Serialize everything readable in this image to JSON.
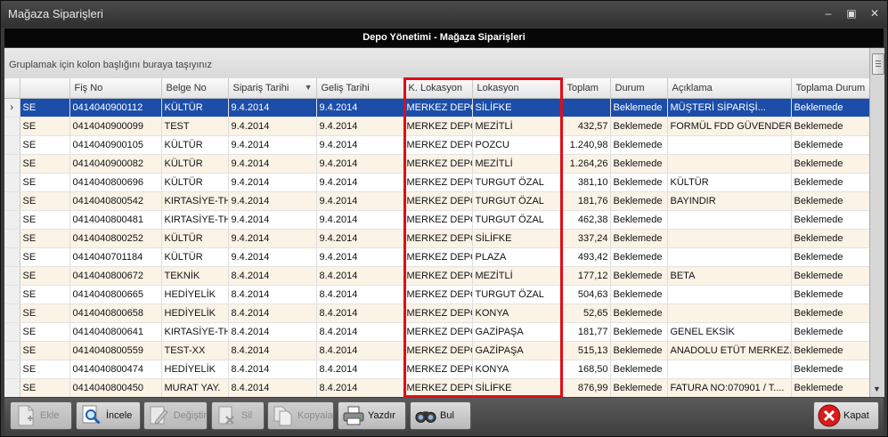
{
  "window": {
    "title": "Mağaza Siparişleri"
  },
  "header": {
    "title": "Depo Yönetimi - Mağaza Siparişleri"
  },
  "group_hint": "Gruplamak için kolon başlığını buraya taşıyınız",
  "columns": [
    "",
    "",
    "Fiş No",
    "Belge No",
    "Sipariş Tarihi",
    "Geliş Tarihi",
    "K. Lokasyon",
    "Lokasyon",
    "Toplam",
    "Durum",
    "Açıklama",
    "Toplama Durum"
  ],
  "rows": [
    [
      "",
      "SE",
      "0414040900112",
      "KÜLTÜR",
      "9.4.2014",
      "9.4.2014",
      "MERKEZ DEPO",
      "SİLİFKE",
      "",
      "Beklemede",
      "MÜŞTERİ SİPARİŞİ...",
      "Beklemede"
    ],
    [
      "",
      "SE",
      "0414040900099",
      "TEST",
      "9.4.2014",
      "9.4.2014",
      "MERKEZ DEPO",
      "MEZİTLİ",
      "432,57",
      "Beklemede",
      "FORMÜL FDD GÜVENDER...",
      "Beklemede"
    ],
    [
      "",
      "SE",
      "0414040900105",
      "KÜLTÜR",
      "9.4.2014",
      "9.4.2014",
      "MERKEZ DEPO",
      "POZCU",
      "1.240,98",
      "Beklemede",
      "",
      "Beklemede"
    ],
    [
      "",
      "SE",
      "0414040900082",
      "KÜLTÜR",
      "9.4.2014",
      "9.4.2014",
      "MERKEZ DEPO",
      "MEZİTLİ",
      "1.264,26",
      "Beklemede",
      "",
      "Beklemede"
    ],
    [
      "",
      "SE",
      "0414040800696",
      "KÜLTÜR",
      "9.4.2014",
      "9.4.2014",
      "MERKEZ DEPO",
      "TURGUT ÖZAL",
      "381,10",
      "Beklemede",
      "KÜLTÜR",
      "Beklemede"
    ],
    [
      "",
      "SE",
      "0414040800542",
      "KIRTASİYE-TH",
      "9.4.2014",
      "9.4.2014",
      "MERKEZ DEPO",
      "TURGUT ÖZAL",
      "181,76",
      "Beklemede",
      "BAYINDIR",
      "Beklemede"
    ],
    [
      "",
      "SE",
      "0414040800481",
      "KIRTASİYE-TH",
      "9.4.2014",
      "9.4.2014",
      "MERKEZ DEPO",
      "TURGUT ÖZAL",
      "462,38",
      "Beklemede",
      "",
      "Beklemede"
    ],
    [
      "",
      "SE",
      "0414040800252",
      "KÜLTÜR",
      "9.4.2014",
      "9.4.2014",
      "MERKEZ DEPO",
      "SİLİFKE",
      "337,24",
      "Beklemede",
      "",
      "Beklemede"
    ],
    [
      "",
      "SE",
      "0414040701184",
      "KÜLTÜR",
      "9.4.2014",
      "9.4.2014",
      "MERKEZ DEPO",
      "PLAZA",
      "493,42",
      "Beklemede",
      "",
      "Beklemede"
    ],
    [
      "",
      "SE",
      "0414040800672",
      "TEKNİK",
      "8.4.2014",
      "8.4.2014",
      "MERKEZ DEPO",
      "MEZİTLİ",
      "177,12",
      "Beklemede",
      "BETA",
      "Beklemede"
    ],
    [
      "",
      "SE",
      "0414040800665",
      "HEDİYELİK",
      "8.4.2014",
      "8.4.2014",
      "MERKEZ DEPO",
      "TURGUT ÖZAL",
      "504,63",
      "Beklemede",
      "",
      "Beklemede"
    ],
    [
      "",
      "SE",
      "0414040800658",
      "HEDİYELİK",
      "8.4.2014",
      "8.4.2014",
      "MERKEZ DEPO",
      "KONYA",
      "52,65",
      "Beklemede",
      "",
      "Beklemede"
    ],
    [
      "",
      "SE",
      "0414040800641",
      "KIRTASİYE-TH",
      "8.4.2014",
      "8.4.2014",
      "MERKEZ DEPO",
      "GAZİPAŞA",
      "181,77",
      "Beklemede",
      "GENEL EKSİK",
      "Beklemede"
    ],
    [
      "",
      "SE",
      "0414040800559",
      "TEST-XX",
      "8.4.2014",
      "8.4.2014",
      "MERKEZ DEPO",
      "GAZİPAŞA",
      "515,13",
      "Beklemede",
      "ANADOLU ETÜT MERKEZ...",
      "Beklemede"
    ],
    [
      "",
      "SE",
      "0414040800474",
      "HEDİYELİK",
      "8.4.2014",
      "8.4.2014",
      "MERKEZ DEPO",
      "KONYA",
      "168,50",
      "Beklemede",
      "",
      "Beklemede"
    ],
    [
      "",
      "SE",
      "0414040800450",
      "MURAT YAY.",
      "8.4.2014",
      "8.4.2014",
      "MERKEZ DEPO",
      "SİLİFKE",
      "876,99",
      "Beklemede",
      "FATURA NO:070901 / T....",
      "Beklemede"
    ]
  ],
  "toolbar": {
    "ekle": "Ekle",
    "incele": "İncele",
    "degistir": "Değiştir",
    "sil": "Sil",
    "kopyala": "Kopyala",
    "yazdir": "Yazdır",
    "bul": "Bul",
    "kapat": "Kapat"
  },
  "colors": {
    "highlight": "#e10c15",
    "selected_row": "#1c4ea9",
    "alt_row": "#fbf3e6"
  }
}
